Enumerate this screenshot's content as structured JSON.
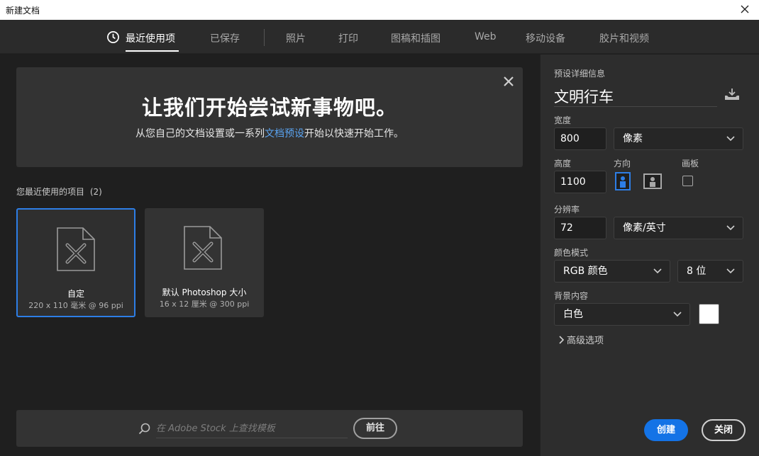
{
  "window": {
    "title": "新建文档"
  },
  "tabs": [
    {
      "label": "最近使用项",
      "active": true
    },
    {
      "label": "已保存"
    },
    {
      "label": "照片"
    },
    {
      "label": "打印"
    },
    {
      "label": "图稿和插图"
    },
    {
      "label": "Web"
    },
    {
      "label": "移动设备"
    },
    {
      "label": "胶片和视频"
    }
  ],
  "welcome": {
    "heading": "让我们开始尝试新事物吧。",
    "sub_before": "从您自己的文档设置或一系列",
    "sub_link": "文档预设",
    "sub_after": "开始以快速开始工作。"
  },
  "recent": {
    "label": "您最近使用的项目",
    "count": "(2)",
    "items": [
      {
        "name": "自定",
        "meta": "220 x 110 毫米 @ 96 ppi",
        "selected": true
      },
      {
        "name": "默认 Photoshop 大小",
        "meta": "16 x 12 厘米 @ 300 ppi",
        "selected": false
      }
    ]
  },
  "search": {
    "placeholder": "在 Adobe Stock 上查找模板",
    "go_label": "前往"
  },
  "preset": {
    "section_label": "预设详细信息",
    "doc_name": "文明行车",
    "width_label": "宽度",
    "width_value": "800",
    "width_unit": "像素",
    "height_label": "高度",
    "height_value": "1100",
    "orientation_label": "方向",
    "orientation": "portrait",
    "artboard_label": "画板",
    "artboard_checked": false,
    "resolution_label": "分辨率",
    "resolution_value": "72",
    "resolution_unit": "像素/英寸",
    "color_mode_label": "颜色模式",
    "color_mode": "RGB 颜色",
    "bit_depth": "8 位",
    "background_label": "背景内容",
    "background": "白色",
    "background_color": "#ffffff",
    "advanced_label": "高级选项"
  },
  "actions": {
    "create_label": "创建",
    "close_label": "关闭"
  },
  "colors": {
    "accent": "#1473e6",
    "link": "#5aa3f0",
    "selected_border": "#2d7ee6"
  }
}
